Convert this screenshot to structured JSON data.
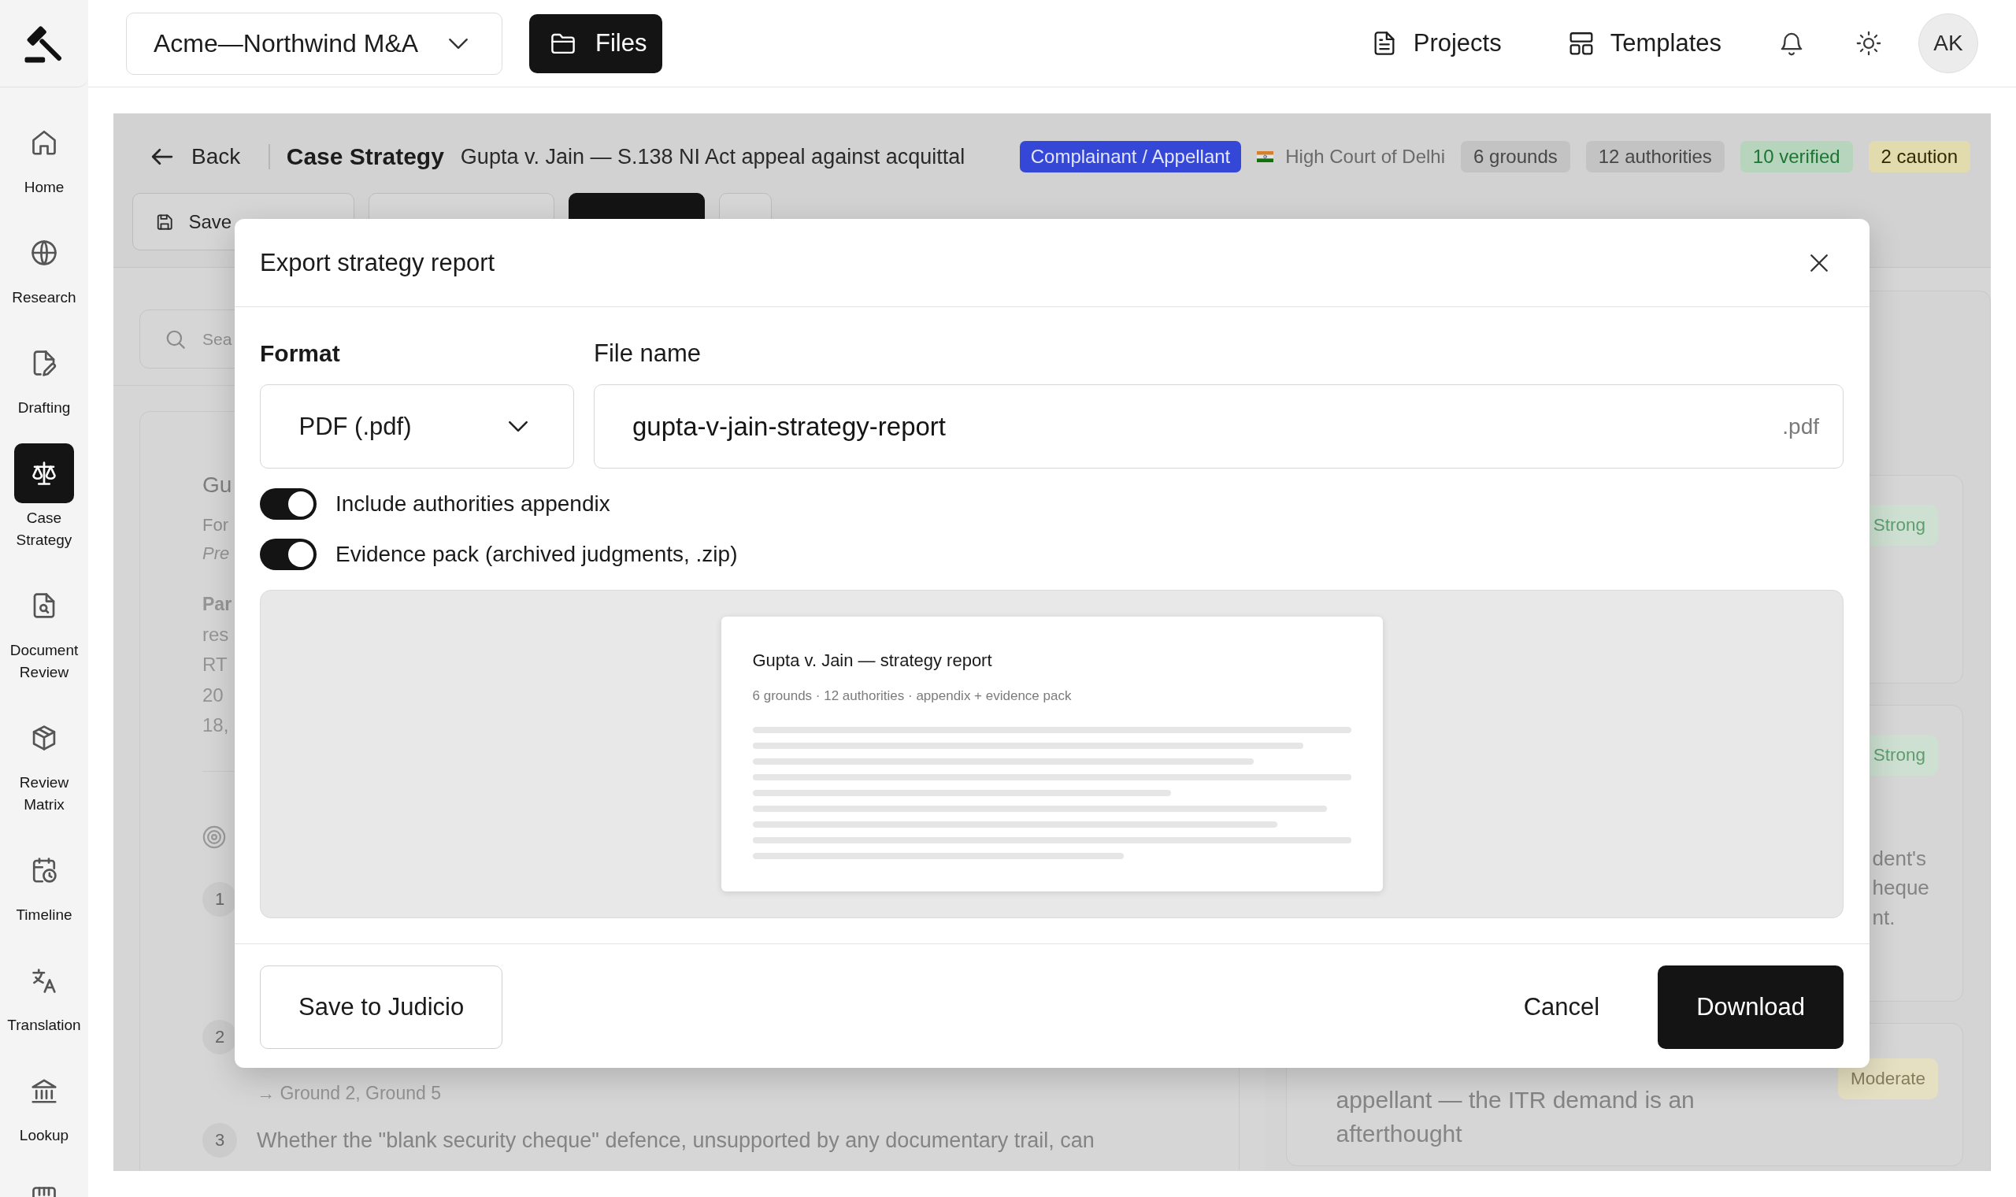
{
  "sidebar": {
    "items": [
      {
        "label": "Home",
        "selected": false
      },
      {
        "label": "Research",
        "selected": false
      },
      {
        "label": "Drafting",
        "selected": false
      },
      {
        "label": "Case Strategy",
        "selected": true
      },
      {
        "label": "Document Review",
        "selected": false
      },
      {
        "label": "Review Matrix",
        "selected": false
      },
      {
        "label": "Timeline",
        "selected": false
      },
      {
        "label": "Translation",
        "selected": false
      },
      {
        "label": "Lookup",
        "selected": false
      }
    ]
  },
  "topbar": {
    "workspace": "Acme—Northwind M&A",
    "files_button": "Files",
    "links": [
      {
        "label": "Projects"
      },
      {
        "label": "Templates"
      }
    ],
    "avatar": "AK"
  },
  "case_header": {
    "back": "Back",
    "title": "Case Strategy",
    "subtitle": "Gupta v. Jain — S.138 NI Act appeal against acquittal",
    "role": "Complainant / Appellant",
    "court": "High Court of Delhi",
    "stats": [
      {
        "label": "6 grounds",
        "kind": "neutral"
      },
      {
        "label": "12 authorities",
        "kind": "neutral"
      },
      {
        "label": "10 verified",
        "kind": "verified"
      },
      {
        "label": "2 caution",
        "kind": "caution"
      }
    ]
  },
  "toolbar": {
    "buttons": [
      {
        "label": "Save",
        "kind": "outline"
      },
      {
        "kind": "outline"
      },
      {
        "kind": "primary"
      },
      {
        "kind": "icon"
      }
    ]
  },
  "search": {
    "placeholder": "Sea"
  },
  "brief_card": {
    "heading": "Gu",
    "meta": [
      {
        "text": "For",
        "kind": "plain"
      },
      {
        "text": "Pre",
        "kind": "italic"
      }
    ],
    "summary": [
      {
        "text": "Par",
        "kind": "bold"
      },
      {
        "text": "res",
        "kind": "plain"
      },
      {
        "text": "RT",
        "kind": "plain"
      },
      {
        "text": "20",
        "kind": "plain"
      },
      {
        "text": "18,",
        "kind": "plain"
      }
    ],
    "issues": [
      {
        "number": "1"
      },
      {
        "number": "2",
        "refs": "→ Ground 2, Ground 5"
      },
      {
        "number": "3",
        "text": "Whether the \"blank security cheque\" defence, unsupported by any documentary trail, can"
      }
    ]
  },
  "assessments": {
    "cards": [
      {
        "badge": "Strong",
        "kind": "strong"
      },
      {
        "badge": "Strong",
        "kind": "strong",
        "lines": [
          "dent's",
          "heque",
          "nt."
        ]
      },
      {
        "badge": "Moderate",
        "kind": "moderate",
        "lines": [
          "appellant — the ITR demand is an",
          "afterthought"
        ]
      }
    ]
  },
  "export_dialog": {
    "title": "Export strategy report",
    "format": {
      "label": "Format",
      "value": "PDF (.pdf)"
    },
    "file_name": {
      "label": "File name",
      "value": "gupta-v-jain-strategy-report",
      "suffix": ".pdf"
    },
    "options": [
      {
        "label": "Include authorities appendix",
        "on": true
      },
      {
        "label": "Evidence pack (archived judgments, .zip)",
        "on": true
      }
    ],
    "preview": {
      "title": "Gupta v. Jain — strategy report",
      "meta": "6 grounds · 12 authorities · appendix + evidence pack"
    },
    "buttons": [
      {
        "label": "Save to Judicio",
        "kind": "secondary"
      },
      {
        "label": "Cancel",
        "kind": "text"
      },
      {
        "label": "Download",
        "kind": "primary"
      }
    ]
  }
}
